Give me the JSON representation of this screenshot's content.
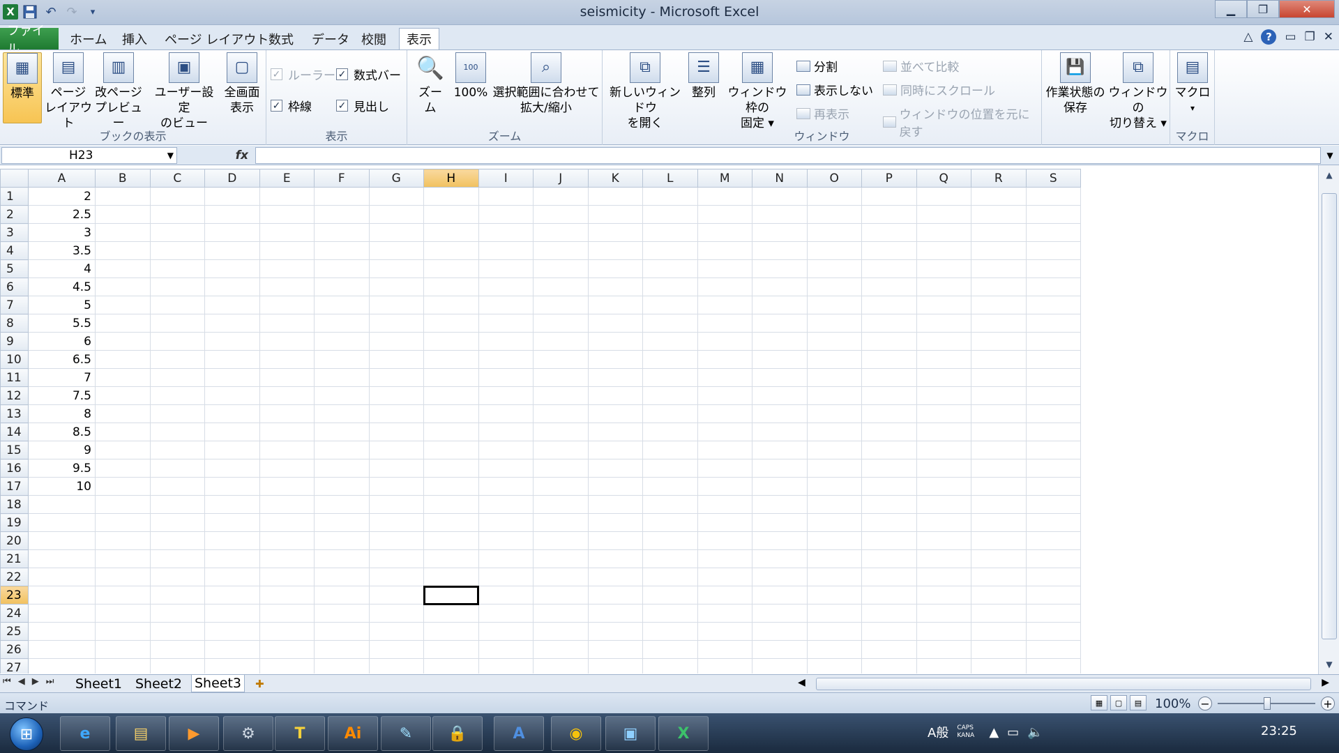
{
  "window": {
    "title": "seismicity - Microsoft Excel",
    "minimize_glyph": "▁",
    "restore_glyph": "❐",
    "close_glyph": "✕"
  },
  "qat": {
    "save_icon": "save-icon",
    "undo_glyph": "↶",
    "redo_glyph": "↷",
    "customize_glyph": "▾",
    "excel_glyph": "X"
  },
  "tabs": [
    {
      "label": "ファイル"
    },
    {
      "label": "ホーム"
    },
    {
      "label": "挿入"
    },
    {
      "label": "ページ レイアウト"
    },
    {
      "label": "数式"
    },
    {
      "label": "データ"
    },
    {
      "label": "校閲"
    },
    {
      "label": "表示"
    }
  ],
  "ribbon_right": {
    "help_glyph": "?",
    "collapse_glyph": "△",
    "min_glyph": "▭",
    "restore_glyph": "❐",
    "close_glyph": "✕"
  },
  "ribbon": {
    "book_view": {
      "label": "ブックの表示",
      "normal": "標準",
      "page_layout": [
        "ページ",
        "レイアウト"
      ],
      "page_break": [
        "改ページ",
        "プレビュー"
      ],
      "custom_view": [
        "ユーザー設定",
        "のビュー"
      ],
      "full_screen": [
        "全画面",
        "表示"
      ]
    },
    "show": {
      "label": "表示",
      "ruler": "ルーラー",
      "formula_bar": "数式バー",
      "gridlines": "枠線",
      "headings": "見出し",
      "check_glyph": "✓"
    },
    "zoom": {
      "label": "ズーム",
      "zoom": "ズーム",
      "hundred": "100%",
      "zoom_selection": [
        "選択範囲に合わせて",
        "拡大/縮小"
      ]
    },
    "window": {
      "label": "ウィンドウ",
      "new_window": [
        "新しいウィンドウ",
        "を開く"
      ],
      "arrange": "整列",
      "freeze": [
        "ウィンドウ枠の",
        "固定 ▾"
      ],
      "split": "分割",
      "hide": "表示しない",
      "unhide": "再表示",
      "side_by_side": "並べて比較",
      "sync_scroll": "同時にスクロール",
      "reset_position": "ウィンドウの位置を元に戻す",
      "save_workspace": [
        "作業状態の",
        "保存"
      ],
      "switch_windows": [
        "ウィンドウの",
        "切り替え ▾"
      ]
    },
    "macros": {
      "label": "マクロ",
      "macros": "マクロ",
      "arrow": "▾"
    }
  },
  "formula_bar": {
    "name_box": "H23",
    "fx": "fx",
    "formula": "",
    "dropdown_glyph": "▼",
    "expand_glyph": "▼"
  },
  "grid": {
    "columns": [
      "A",
      "B",
      "C",
      "D",
      "E",
      "F",
      "G",
      "H",
      "I",
      "J",
      "K",
      "L",
      "M",
      "N",
      "O",
      "P",
      "Q",
      "R",
      "S"
    ],
    "rows": [
      "1",
      "2",
      "3",
      "4",
      "5",
      "6",
      "7",
      "8",
      "9",
      "10",
      "11",
      "12",
      "13",
      "14",
      "15",
      "16",
      "17",
      "18",
      "19",
      "20",
      "21",
      "22",
      "23",
      "24",
      "25",
      "26",
      "27"
    ],
    "column_a_values": [
      "2",
      "2.5",
      "3",
      "3.5",
      "4",
      "4.5",
      "5",
      "5.5",
      "6",
      "6.5",
      "7",
      "7.5",
      "8",
      "8.5",
      "9",
      "9.5",
      "10"
    ],
    "selected_cell": "H23"
  },
  "sheets": {
    "nav": [
      "⏮",
      "◀",
      "▶",
      "⏭"
    ],
    "tabs": [
      "Sheet1",
      "Sheet2",
      "Sheet3"
    ],
    "active": "Sheet3",
    "new_sheet_glyph": "✚"
  },
  "scroll": {
    "up": "▲",
    "down": "▼",
    "left": "◀",
    "right": "▶"
  },
  "status": {
    "mode": "コマンド",
    "zoom": "100%",
    "zoom_out": "−",
    "zoom_in": "+"
  },
  "taskbar": {
    "start_glyph": "⊞",
    "apps": [
      {
        "name": "internet-explorer",
        "glyph": "e",
        "color": "#3fa9ff"
      },
      {
        "name": "file-explorer",
        "glyph": "▤",
        "color": "#f3cf6a"
      },
      {
        "name": "media-player",
        "glyph": "▶",
        "color": "#ff9a2e"
      },
      {
        "name": "remote-desktop",
        "glyph": "⚙",
        "color": "#cfd8e3"
      },
      {
        "name": "text-editor",
        "glyph": "T",
        "color": "#f5d13b"
      },
      {
        "name": "illustrator",
        "glyph": "Ai",
        "color": "#ff8a00"
      },
      {
        "name": "notepad",
        "glyph": "✎",
        "color": "#9fe0ff"
      },
      {
        "name": "security-tool",
        "glyph": "🔒",
        "color": "#c8d4e0"
      },
      {
        "name": "word-app",
        "glyph": "A",
        "color": "#4f8fe0"
      },
      {
        "name": "chrome",
        "glyph": "◉",
        "color": "#f4c20d"
      },
      {
        "name": "photo-viewer",
        "glyph": "▣",
        "color": "#8fd0ff"
      },
      {
        "name": "excel",
        "glyph": "X",
        "color": "#3cc26a"
      }
    ],
    "tray_ime": "A般",
    "tray_caps": "CAPS KANA",
    "clock": "23:25"
  }
}
